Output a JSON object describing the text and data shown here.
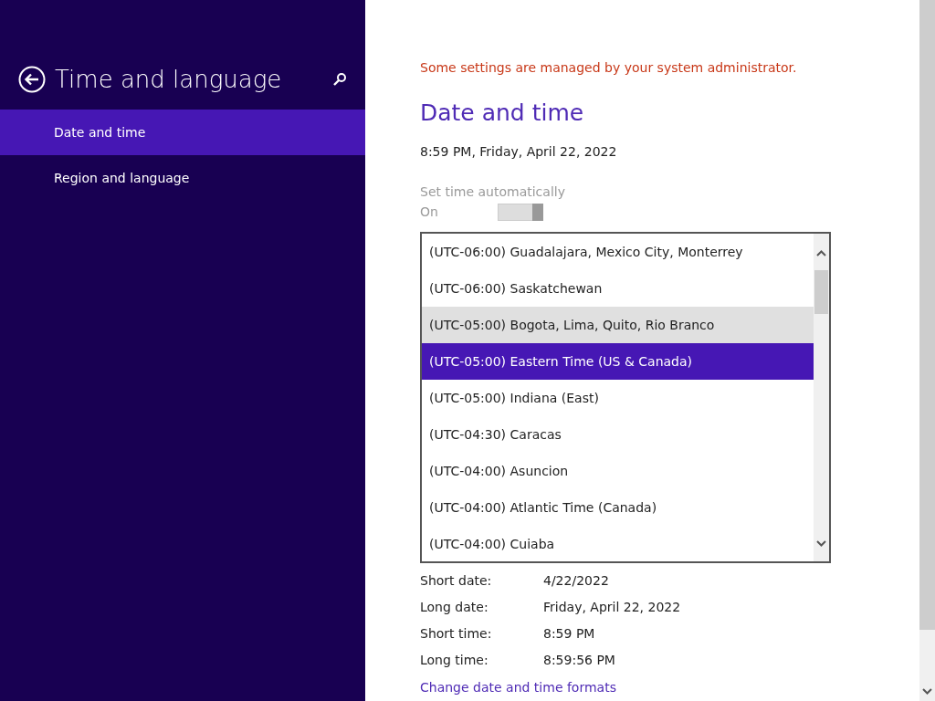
{
  "sidebar": {
    "title": "Time and language",
    "items": [
      {
        "label": "Date and time",
        "selected": true
      },
      {
        "label": "Region and language",
        "selected": false
      }
    ]
  },
  "notice": "Some settings are managed by your system administrator.",
  "heading": "Date and time",
  "current_time": "8:59 PM, Friday, April 22, 2022",
  "auto_time": {
    "label": "Set time automatically",
    "state_text": "On",
    "on": true,
    "disabled": true
  },
  "timezone_list": [
    {
      "label": "(UTC-06:00) Guadalajara, Mexico City, Monterrey",
      "selected": false,
      "hovered": false
    },
    {
      "label": "(UTC-06:00) Saskatchewan",
      "selected": false,
      "hovered": false
    },
    {
      "label": "(UTC-05:00) Bogota, Lima, Quito, Rio Branco",
      "selected": false,
      "hovered": true
    },
    {
      "label": "(UTC-05:00) Eastern Time (US & Canada)",
      "selected": true,
      "hovered": false
    },
    {
      "label": "(UTC-05:00) Indiana (East)",
      "selected": false,
      "hovered": false
    },
    {
      "label": "(UTC-04:30) Caracas",
      "selected": false,
      "hovered": false
    },
    {
      "label": "(UTC-04:00) Asuncion",
      "selected": false,
      "hovered": false
    },
    {
      "label": "(UTC-04:00) Atlantic Time (Canada)",
      "selected": false,
      "hovered": false
    },
    {
      "label": "(UTC-04:00) Cuiaba",
      "selected": false,
      "hovered": false
    }
  ],
  "formats": [
    {
      "label": "Short date:",
      "value": "4/22/2022"
    },
    {
      "label": "Long date:",
      "value": "Friday, April 22, 2022"
    },
    {
      "label": "Short time:",
      "value": "8:59 PM"
    },
    {
      "label": "Long time:",
      "value": "8:59:56 PM"
    }
  ],
  "formats_link": "Change date and time formats"
}
